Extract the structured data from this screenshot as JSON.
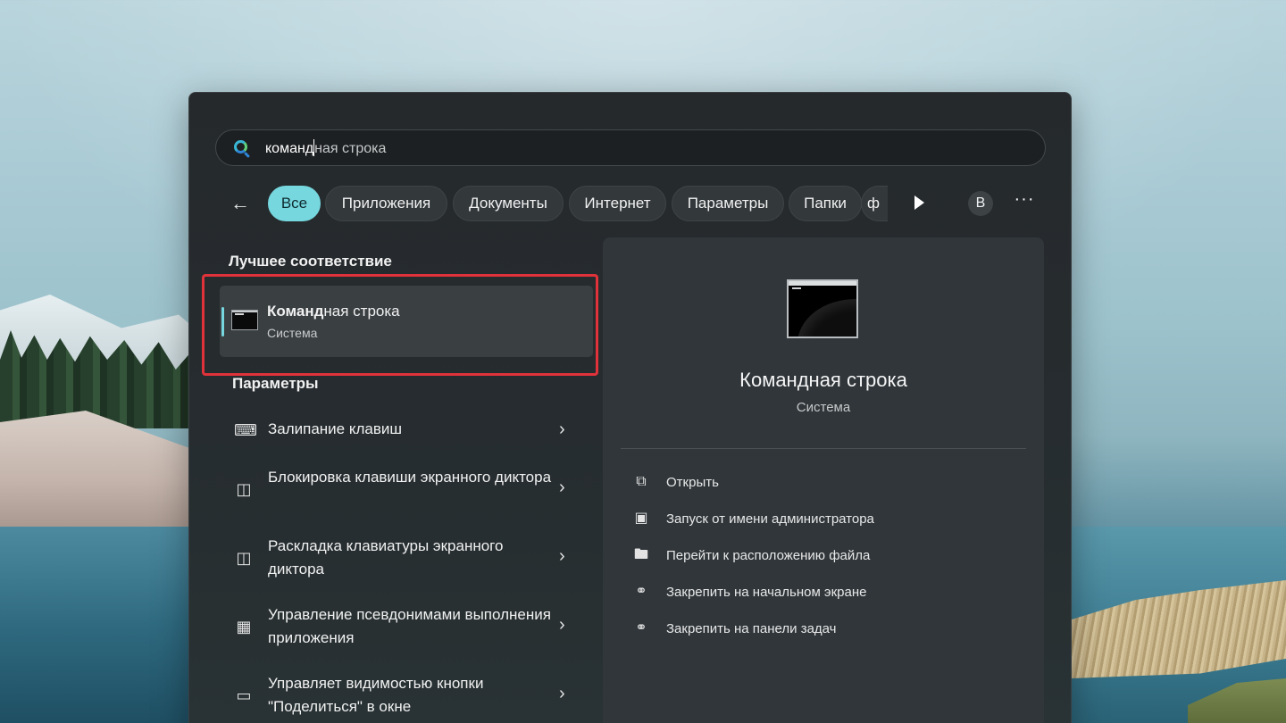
{
  "search": {
    "typed": "команд",
    "rest": "ная строка"
  },
  "filters": {
    "back_icon": "arrow-left-icon",
    "chips": [
      {
        "label": "Все",
        "active": true
      },
      {
        "label": "Приложения",
        "active": false
      },
      {
        "label": "Документы",
        "active": false
      },
      {
        "label": "Интернет",
        "active": false
      },
      {
        "label": "Параметры",
        "active": false
      },
      {
        "label": "Папки",
        "active": false
      },
      {
        "label": "ф",
        "active": false
      }
    ],
    "avatar_letter": "В",
    "more": "···"
  },
  "best_match": {
    "section_title": "Лучшее соответствие",
    "title_bold": "Команд",
    "title_rest": "ная строка",
    "subtitle": "Система"
  },
  "settings": {
    "section_title": "Параметры",
    "items": [
      {
        "label": "Залипание клавиш",
        "icon": "keyboard-icon"
      },
      {
        "label": "Блокировка клавиши экранного диктора",
        "icon": "narrator-lock-icon"
      },
      {
        "label": "Раскладка клавиатуры экранного диктора",
        "icon": "narrator-keyboard-icon"
      },
      {
        "label": "Управление псевдонимами выполнения приложения",
        "icon": "app-alias-icon"
      },
      {
        "label": "Управляет видимостью кнопки \"Поделиться\" в окне",
        "icon": "share-window-icon"
      }
    ]
  },
  "preview": {
    "title": "Командная строка",
    "subtitle": "Система",
    "actions": [
      {
        "label": "Открыть",
        "icon": "open-external-icon"
      },
      {
        "label": "Запуск от имени администратора",
        "icon": "admin-shield-icon"
      },
      {
        "label": "Перейти к расположению файла",
        "icon": "folder-icon"
      },
      {
        "label": "Закрепить на начальном экране",
        "icon": "pin-icon"
      },
      {
        "label": "Закрепить на панели задач",
        "icon": "pin-icon"
      }
    ]
  },
  "colors": {
    "accent": "#76d7de",
    "highlight_border": "#e0323a",
    "panel_bg": "#262c2f"
  }
}
